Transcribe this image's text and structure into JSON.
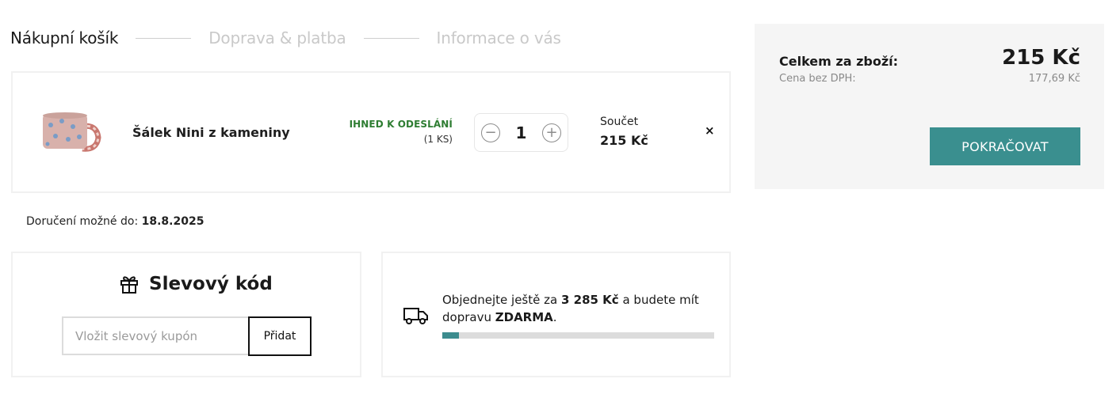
{
  "steps": [
    {
      "label": "Nákupní košík",
      "state": "active"
    },
    {
      "label": "Doprava & platba",
      "state": "inactive"
    },
    {
      "label": "Informace o vás",
      "state": "inactive"
    }
  ],
  "cart": {
    "item": {
      "name": "Šálek Nini z kameniny",
      "availability": "IHNED K ODESLÁNÍ",
      "stock_note": "(1 KS)",
      "quantity": "1",
      "sum_label": "Součet",
      "sum_value": "215 Kč",
      "remove_icon": "×"
    }
  },
  "delivery": {
    "label": "Doručení možné do:",
    "date": "18.8.2025"
  },
  "coupon": {
    "title": "Slevový kód",
    "placeholder": "Vložit slevový kupón",
    "button": "Přidat"
  },
  "shipping": {
    "text_before": "Objednejte ještě za",
    "amount": "3 285 Kč",
    "text_middle": "a budete mít dopravu",
    "free": "ZDARMA",
    "text_after": ".",
    "progress": 0.06
  },
  "summary": {
    "total_label": "Celkem za zboží:",
    "total_value": "215 Kč",
    "net_label": "Cena bez DPH:",
    "net_value": "177,69 Kč",
    "continue": "POKRAČOVAT"
  },
  "colors": {
    "accent": "#3a8f8f",
    "available": "#2e7d32"
  }
}
